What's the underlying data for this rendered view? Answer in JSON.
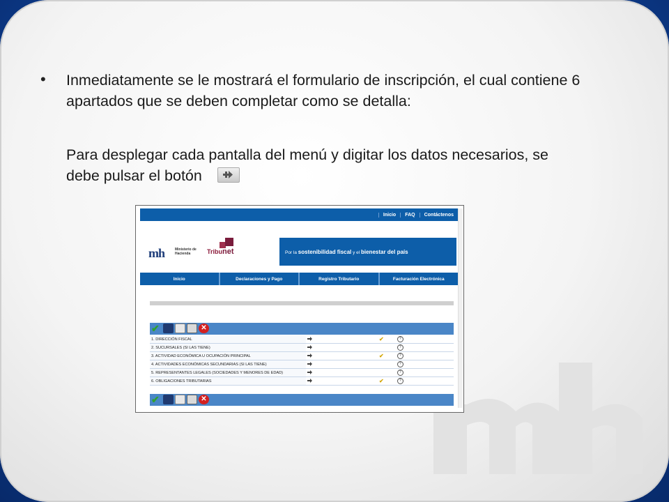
{
  "slide": {
    "bullet": "•",
    "paragraph1": "Inmediatamente se le mostrará el formulario de inscripción, el cual contiene 6 apartados que  se deben completar como se detalla:",
    "paragraph2": "Para desplegar cada pantalla del menú y digitar los datos necesarios, se debe pulsar el botón"
  },
  "screenshot": {
    "top_links": [
      "Inicio",
      "FAQ",
      "Contáctenos"
    ],
    "logo": {
      "mh": "mh",
      "ministry_line1": "Ministerio de",
      "ministry_line2": "Hacienda",
      "tribu": "Tribu",
      "net": "net"
    },
    "slogan": {
      "p1": "Por la ",
      "b1": "sostenibilidad fiscal",
      "p2": " y el ",
      "b2": "bienestar del país"
    },
    "main_nav": [
      "Inicio",
      "Declaraciones y Pago",
      "Registro Tributario",
      "Facturación Electrónica"
    ],
    "sections": [
      {
        "label": "1. DIRECCIÓN FISCAL",
        "done": true
      },
      {
        "label": "2. SUCURSALES (SI LAS TIENE)",
        "done": false
      },
      {
        "label": "3. ACTIVIDAD ECONÓMICA U OCUPACIÓN PRINCIPAL",
        "done": true
      },
      {
        "label": "4. ACTIVIDADES ECONÓMICAS SECUNDARIAS (SI LAS TIENE)",
        "done": false
      },
      {
        "label": "5. REPRESENTANTES LEGALES (SOCIEDADES Y MENORES DE EDAD)",
        "done": false
      },
      {
        "label": "6. OBLIGACIONES TRIBUTARIAS",
        "done": true
      }
    ],
    "toolbar_icons": [
      "check-icon",
      "save-icon",
      "copy-icon",
      "print-icon",
      "close-icon"
    ]
  }
}
